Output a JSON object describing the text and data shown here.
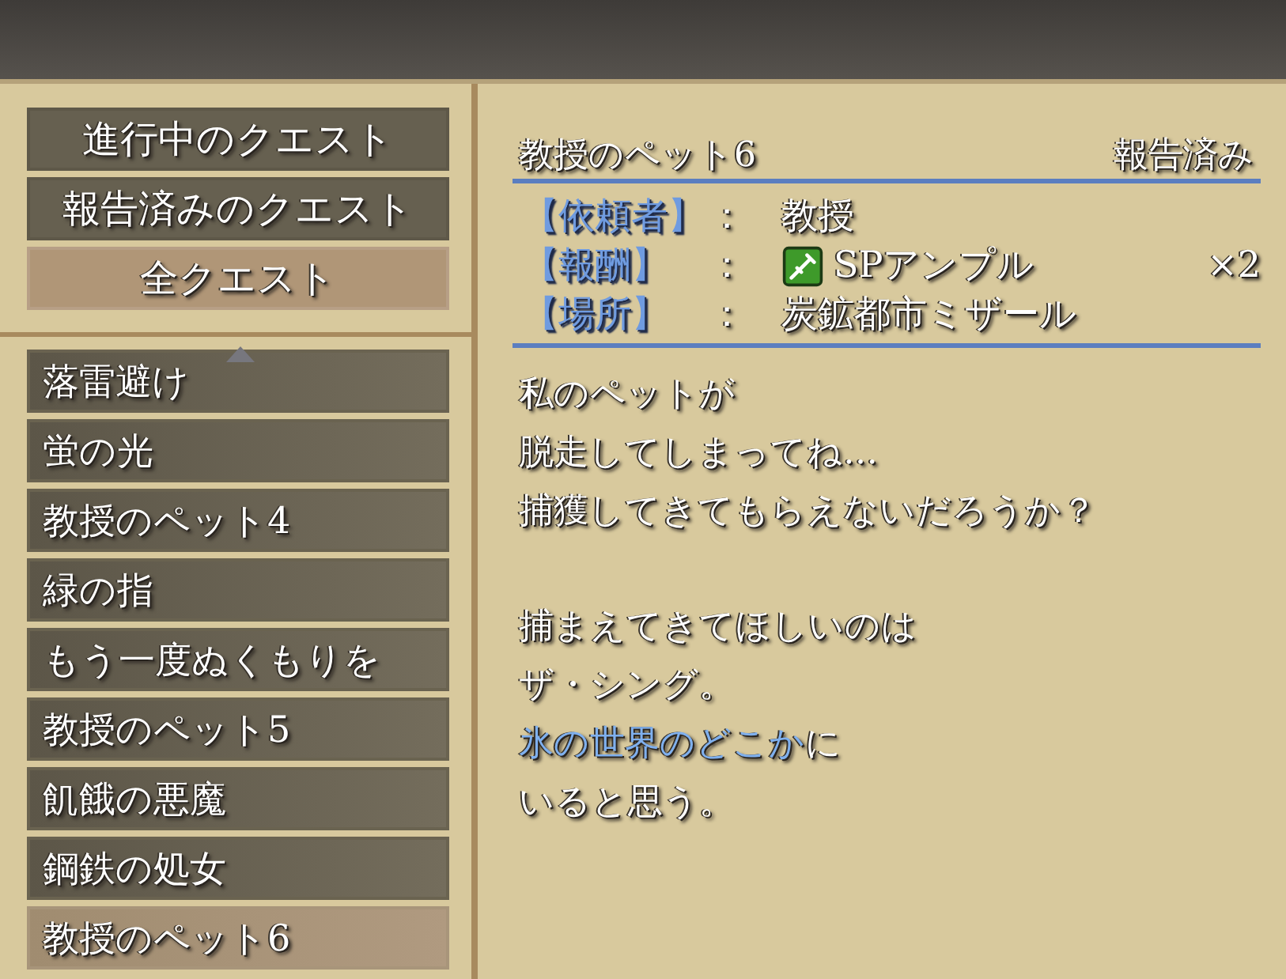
{
  "filters": [
    {
      "label": "進行中のクエスト",
      "selected": false
    },
    {
      "label": "報告済みのクエスト",
      "selected": false
    },
    {
      "label": "全クエスト",
      "selected": true
    }
  ],
  "quests": [
    {
      "label": "落雷避け",
      "selected": false
    },
    {
      "label": "蛍の光",
      "selected": false
    },
    {
      "label": "教授のペット4",
      "selected": false
    },
    {
      "label": "緑の指",
      "selected": false
    },
    {
      "label": "もう一度ぬくもりを",
      "selected": false
    },
    {
      "label": "教授のペット5",
      "selected": false
    },
    {
      "label": "飢餓の悪魔",
      "selected": false
    },
    {
      "label": "鋼鉄の処女",
      "selected": false
    },
    {
      "label": "教授のペット6",
      "selected": true
    }
  ],
  "detail": {
    "title": "教授のペット6",
    "status": "報告済み",
    "fields": [
      {
        "kind": "text",
        "label": "【依頼者】",
        "separator": "：",
        "value": "教授"
      },
      {
        "kind": "item",
        "label": "【報酬】",
        "separator": "：",
        "value": "SPアンプル",
        "quantity": "×2"
      },
      {
        "kind": "text",
        "label": "【場所】",
        "separator": "：",
        "value": "炭鉱都市ミザール"
      }
    ],
    "paragraphs": [
      [
        [
          {
            "text": "私のペットが",
            "highlight": false
          }
        ],
        [
          {
            "text": "脱走してしまってね…",
            "highlight": false
          }
        ],
        [
          {
            "text": "捕獲してきてもらえないだろうか？",
            "highlight": false
          }
        ]
      ],
      [
        [
          {
            "text": "捕まえてきてほしいのは",
            "highlight": false
          }
        ],
        [
          {
            "text": "ザ・シング。",
            "highlight": false
          }
        ],
        [
          {
            "text": "氷の世界のどこか",
            "highlight": true
          },
          {
            "text": "に",
            "highlight": false
          }
        ],
        [
          {
            "text": "いると思う。",
            "highlight": false
          }
        ]
      ]
    ]
  }
}
